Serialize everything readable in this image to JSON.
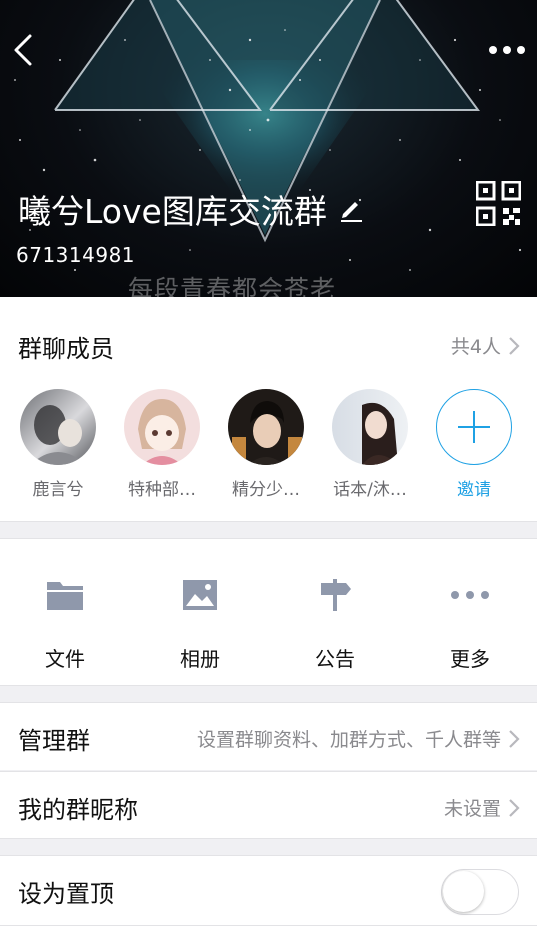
{
  "header": {
    "group_name": "曦兮Love图库交流群",
    "group_id": "671314981",
    "motto": "每段青春都会苍老"
  },
  "members": {
    "title": "群聊成员",
    "count": "共4人",
    "list": [
      {
        "name": "鹿言兮"
      },
      {
        "name": "特种部…"
      },
      {
        "name": "精分少…"
      },
      {
        "name": "话本/沐…"
      }
    ],
    "invite_label": "邀请"
  },
  "tools": {
    "items": [
      {
        "label": "文件",
        "icon": "folder-icon"
      },
      {
        "label": "相册",
        "icon": "photo-icon"
      },
      {
        "label": "公告",
        "icon": "signpost-icon"
      },
      {
        "label": "更多",
        "icon": "more-dots-icon"
      }
    ]
  },
  "settings": {
    "manage": {
      "label": "管理群",
      "value": "设置群聊资料、加群方式、千人群等"
    },
    "nickname": {
      "label": "我的群昵称",
      "value": "未设置"
    },
    "pin": {
      "label": "设为置顶",
      "enabled": false
    }
  },
  "colors": {
    "accent": "#1fa1e4",
    "icon_gray": "#8f98ab",
    "background": "#f0f0f3"
  }
}
